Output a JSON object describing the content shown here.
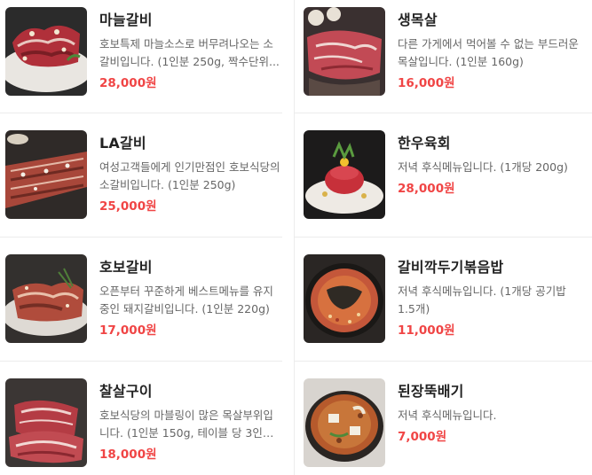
{
  "menu_items": [
    {
      "name": "마늘갈비",
      "desc": "호보특제 마늘소스로 버무려나오는 소갈비입니다. (1인분 250g, 짝수단위...",
      "price": "28,000원",
      "image": "garlic-galbi-photo"
    },
    {
      "name": "생목살",
      "desc": "다른 가게에서 먹어볼 수 없는 부드러운 목살입니다. (1인분 160g)",
      "price": "16,000원",
      "image": "pork-neck-photo"
    },
    {
      "name": "LA갈비",
      "desc": "여성고객들에게 인기만점인 호보식당의 소갈비입니다. (1인분 250g)",
      "price": "25,000원",
      "image": "la-galbi-photo"
    },
    {
      "name": "한우육회",
      "desc": "저녁 후식메뉴입니다. (1개당 200g)",
      "price": "28,000원",
      "image": "hanwoo-yukhoe-photo"
    },
    {
      "name": "호보갈비",
      "desc": "오픈부터 꾸준하게 베스트메뉴를 유지중인 돼지갈비입니다. (1인분 220g)",
      "price": "17,000원",
      "image": "hobo-galbi-photo"
    },
    {
      "name": "갈비깍두기볶음밥",
      "desc": "저녁 후식메뉴입니다. (1개당 공기밥 1.5개)",
      "price": "11,000원",
      "image": "fried-rice-photo"
    },
    {
      "name": "찰살구이",
      "desc": "호보식당의 마블링이 많은 목살부위입니다. (1인분 150g, 테이블 당 3인분 ...",
      "price": "18,000원",
      "image": "chalsal-gui-photo"
    },
    {
      "name": "된장뚝배기",
      "desc": "저녁 후식메뉴입니다.",
      "price": "7,000원",
      "image": "doenjang-stew-photo"
    }
  ],
  "colors": {
    "price": "#f04545",
    "name": "#222222",
    "desc": "#666666",
    "divider": "#ececec"
  }
}
